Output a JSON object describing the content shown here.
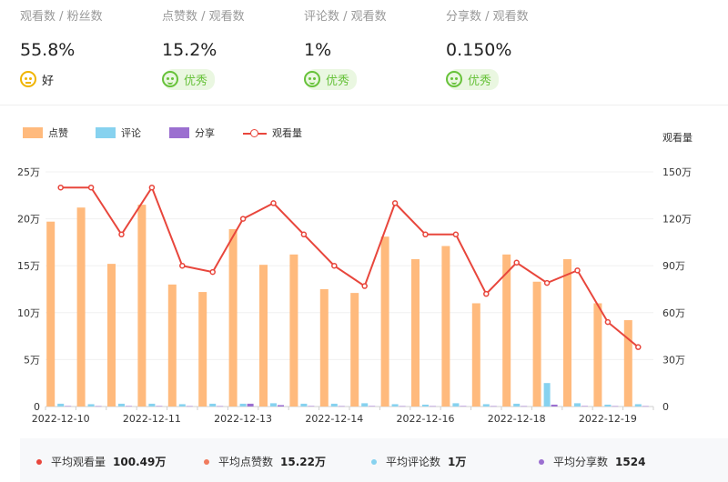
{
  "kpis": [
    {
      "label": "观看数 / 粉丝数",
      "value": "55.8%",
      "rating": "好",
      "level": "good"
    },
    {
      "label": "点赞数 / 观看数",
      "value": "15.2%",
      "rating": "优秀",
      "level": "excellent"
    },
    {
      "label": "评论数 / 观看数",
      "value": "1%",
      "rating": "优秀",
      "level": "excellent"
    },
    {
      "label": "分享数 / 观看数",
      "value": "0.150%",
      "rating": "优秀",
      "level": "excellent"
    }
  ],
  "legend": [
    "点赞",
    "评论",
    "分享",
    "观看量"
  ],
  "colors": {
    "likes": "#ffba7d",
    "comments": "#87d2ef",
    "shares": "#9b6fd0",
    "views": "#e8463c"
  },
  "footer": [
    {
      "label": "平均观看量",
      "value": "100.49万",
      "color": "#e8463c"
    },
    {
      "label": "平均点赞数",
      "value": "15.22万",
      "color": "#f07b5e"
    },
    {
      "label": "平均评论数",
      "value": "1万",
      "color": "#87d2ef"
    },
    {
      "label": "平均分享数",
      "value": "1524",
      "color": "#9b6fd0"
    }
  ],
  "chart_data": {
    "type": "bar",
    "x_tick_labels": [
      "2022-12-10",
      "2022-12-11",
      "2022-12-13",
      "2022-12-14",
      "2022-12-16",
      "2022-12-18",
      "2022-12-19"
    ],
    "y_left_ticks": [
      "0",
      "5万",
      "10万",
      "15万",
      "20万",
      "25万"
    ],
    "y_right_ticks": [
      "0",
      "30万",
      "60万",
      "90万",
      "120万",
      "150万"
    ],
    "y_right_title": "观看量",
    "ylim_left": [
      0,
      250000
    ],
    "ylim_right": [
      0,
      1500000
    ],
    "grid": true,
    "legend_position": "top-left",
    "series": [
      {
        "name": "点赞",
        "kind": "bar",
        "axis": "left",
        "values": [
          197000,
          212000,
          152000,
          215000,
          130000,
          122000,
          189000,
          151000,
          162000,
          125000,
          121000,
          181000,
          157000,
          171000,
          110000,
          162000,
          133000,
          157000,
          110000,
          92000
        ]
      },
      {
        "name": "评论",
        "kind": "bar",
        "axis": "left",
        "values": [
          3000,
          2500,
          3000,
          3000,
          2500,
          3000,
          3000,
          3500,
          3000,
          3000,
          3500,
          2500,
          2000,
          3500,
          2500,
          3000,
          25000,
          3500,
          2000,
          2500
        ]
      },
      {
        "name": "分享",
        "kind": "bar",
        "axis": "left",
        "values": [
          500,
          400,
          500,
          500,
          400,
          400,
          3000,
          1500,
          500,
          400,
          500,
          400,
          400,
          500,
          400,
          400,
          2000,
          500,
          400,
          400
        ]
      },
      {
        "name": "观看量",
        "kind": "line",
        "axis": "right",
        "values": [
          1400000,
          1400000,
          1100000,
          1400000,
          900000,
          860000,
          1200000,
          1300000,
          1100000,
          900000,
          770000,
          1300000,
          1100000,
          1100000,
          720000,
          920000,
          790000,
          870000,
          540000,
          380000
        ]
      }
    ]
  }
}
